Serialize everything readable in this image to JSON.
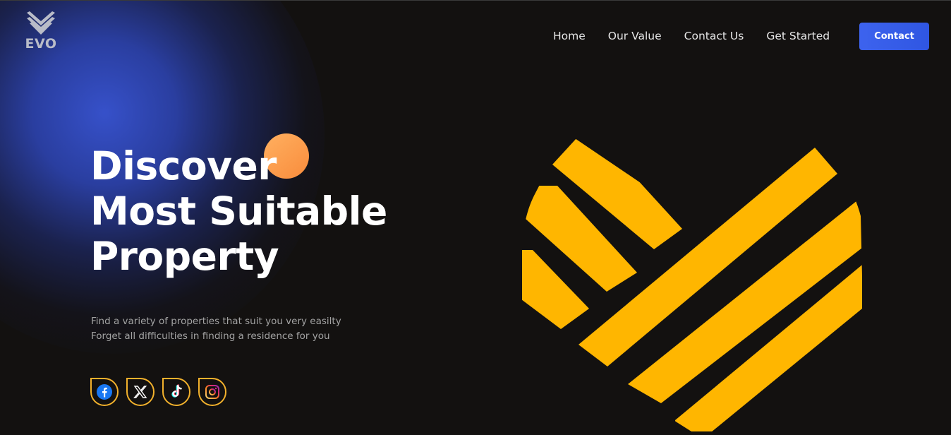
{
  "brand": {
    "logo_text": "EVO",
    "logo_icon": "chevron-stack-icon"
  },
  "nav": {
    "items": [
      {
        "label": "Home"
      },
      {
        "label": "Our Value"
      },
      {
        "label": "Contact Us"
      },
      {
        "label": "Get Started"
      }
    ],
    "cta_label": "Contact"
  },
  "hero": {
    "title_lines": [
      "Discover",
      "Most Suitable",
      "Property"
    ],
    "subtitle_lines": [
      "Find a variety of properties that suit you very easilty",
      "Forget all difficulties in finding a residence for you"
    ]
  },
  "socials": [
    {
      "name": "facebook",
      "icon": "facebook-icon"
    },
    {
      "name": "x",
      "icon": "x-icon"
    },
    {
      "name": "tiktok",
      "icon": "tiktok-icon"
    },
    {
      "name": "instagram",
      "icon": "instagram-icon"
    }
  ],
  "colors": {
    "background": "#131110",
    "accent_blue": "#3a5fec",
    "accent_yellow": "#ffb600",
    "accent_orange": "#fb9a4a",
    "social_border": "#f2b12c"
  }
}
